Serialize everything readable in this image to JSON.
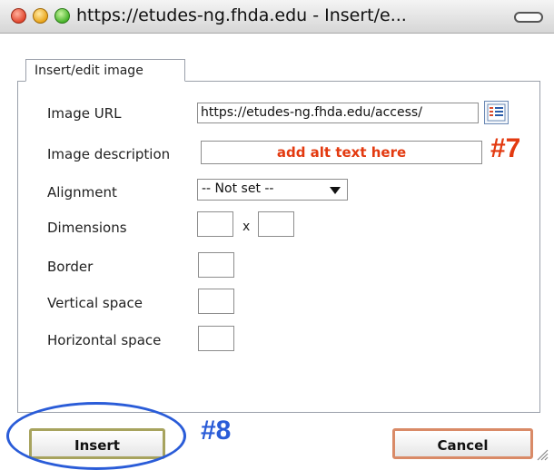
{
  "window": {
    "title": "https://etudes-ng.fhda.edu - Insert/e..."
  },
  "dialog": {
    "tab_label": "Insert/edit image",
    "fields": {
      "image_url": {
        "label": "Image URL",
        "value": "https://etudes-ng.fhda.edu/access/"
      },
      "image_description": {
        "label": "Image description",
        "value": ""
      },
      "alignment": {
        "label": "Alignment",
        "selected": "-- Not set --"
      },
      "dimensions": {
        "label": "Dimensions",
        "width": "",
        "height": "",
        "separator": "x"
      },
      "border": {
        "label": "Border",
        "value": ""
      },
      "vertical_space": {
        "label": "Vertical space",
        "value": ""
      },
      "horizontal_space": {
        "label": "Horizontal space",
        "value": ""
      }
    },
    "buttons": {
      "insert": "Insert",
      "cancel": "Cancel"
    }
  },
  "annotations": {
    "description_hint": "add alt text here",
    "step7": "#7",
    "step8": "#8",
    "hint_color": "#e33a10",
    "highlight_color": "#2a5cd8"
  }
}
